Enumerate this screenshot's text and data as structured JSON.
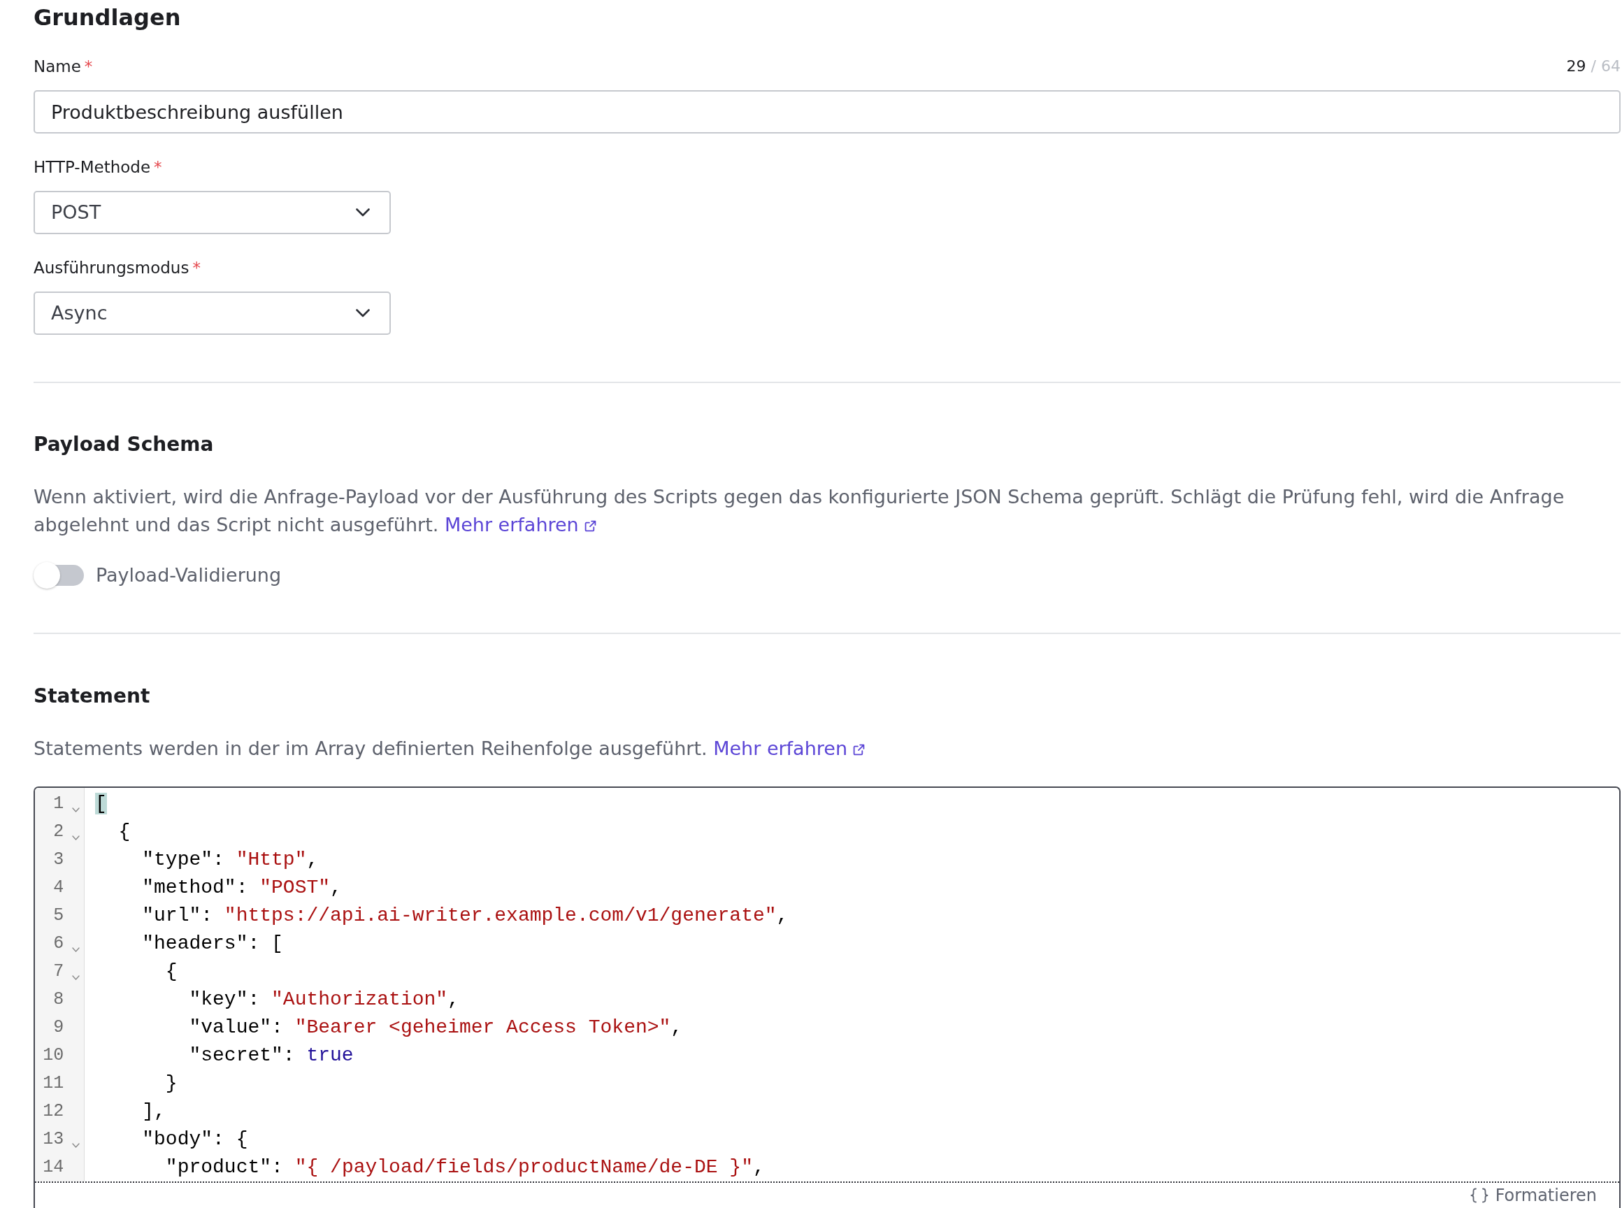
{
  "basics_section": {
    "title": "Grundlagen",
    "fields": [
      {
        "kind": "text",
        "label": "Name",
        "required_mark": "*",
        "value": "Produktbeschreibung ausfüllen",
        "counter": {
          "current": "29",
          "limit": "/ 64"
        }
      },
      {
        "kind": "select",
        "label": "HTTP-Methode",
        "required_mark": "*",
        "value": "POST"
      },
      {
        "kind": "select",
        "label": "Ausführungsmodus",
        "required_mark": "*",
        "value": "Async"
      }
    ]
  },
  "payload_schema_section": {
    "title": "Payload Schema",
    "description": "Wenn aktiviert, wird die Anfrage-Payload vor der Ausführung des Scripts gegen das konfigurierte JSON Schema geprüft. Schlägt die Prüfung fehl, wird die Anfrage abgelehnt und das Script nicht ausgeführt.",
    "link": "Mehr erfahren",
    "toggle": {
      "label": "Payload-Validierung",
      "on": false
    }
  },
  "statement_section": {
    "title": "Statement",
    "description": "Statements werden in der im Array definierten Reihenfolge ausgeführt.",
    "link": "Mehr erfahren",
    "editor": {
      "lines": [
        {
          "number": "1",
          "foldable": true,
          "tokens": [
            {
              "kind": "punct",
              "text": "[",
              "matched": true
            }
          ]
        },
        {
          "number": "2",
          "foldable": true,
          "tokens": [
            {
              "kind": "punct",
              "text": "  {",
              "matched": false
            }
          ]
        },
        {
          "number": "3",
          "foldable": false,
          "tokens": [
            {
              "kind": "key",
              "text": "    \"type\"",
              "matched": false
            },
            {
              "kind": "punct",
              "text": ": ",
              "matched": false
            },
            {
              "kind": "string",
              "text": "\"Http\"",
              "matched": false
            },
            {
              "kind": "punct",
              "text": ",",
              "matched": false
            }
          ]
        },
        {
          "number": "4",
          "foldable": false,
          "tokens": [
            {
              "kind": "key",
              "text": "    \"method\"",
              "matched": false
            },
            {
              "kind": "punct",
              "text": ": ",
              "matched": false
            },
            {
              "kind": "string",
              "text": "\"POST\"",
              "matched": false
            },
            {
              "kind": "punct",
              "text": ",",
              "matched": false
            }
          ]
        },
        {
          "number": "5",
          "foldable": false,
          "tokens": [
            {
              "kind": "key",
              "text": "    \"url\"",
              "matched": false
            },
            {
              "kind": "punct",
              "text": ": ",
              "matched": false
            },
            {
              "kind": "string",
              "text": "\"https://api.ai-writer.example.com/v1/generate\"",
              "matched": false
            },
            {
              "kind": "punct",
              "text": ",",
              "matched": false
            }
          ]
        },
        {
          "number": "6",
          "foldable": true,
          "tokens": [
            {
              "kind": "key",
              "text": "    \"headers\"",
              "matched": false
            },
            {
              "kind": "punct",
              "text": ": [",
              "matched": false
            }
          ]
        },
        {
          "number": "7",
          "foldable": true,
          "tokens": [
            {
              "kind": "punct",
              "text": "      {",
              "matched": false
            }
          ]
        },
        {
          "number": "8",
          "foldable": false,
          "tokens": [
            {
              "kind": "key",
              "text": "        \"key\"",
              "matched": false
            },
            {
              "kind": "punct",
              "text": ": ",
              "matched": false
            },
            {
              "kind": "string",
              "text": "\"Authorization\"",
              "matched": false
            },
            {
              "kind": "punct",
              "text": ",",
              "matched": false
            }
          ]
        },
        {
          "number": "9",
          "foldable": false,
          "tokens": [
            {
              "kind": "key",
              "text": "        \"value\"",
              "matched": false
            },
            {
              "kind": "punct",
              "text": ": ",
              "matched": false
            },
            {
              "kind": "string",
              "text": "\"Bearer <geheimer Access Token>\"",
              "matched": false
            },
            {
              "kind": "punct",
              "text": ",",
              "matched": false
            }
          ]
        },
        {
          "number": "10",
          "foldable": false,
          "tokens": [
            {
              "kind": "key",
              "text": "        \"secret\"",
              "matched": false
            },
            {
              "kind": "punct",
              "text": ": ",
              "matched": false
            },
            {
              "kind": "literal",
              "text": "true",
              "matched": false
            }
          ]
        },
        {
          "number": "11",
          "foldable": false,
          "tokens": [
            {
              "kind": "punct",
              "text": "      }",
              "matched": false
            }
          ]
        },
        {
          "number": "12",
          "foldable": false,
          "tokens": [
            {
              "kind": "punct",
              "text": "    ],",
              "matched": false
            }
          ]
        },
        {
          "number": "13",
          "foldable": true,
          "tokens": [
            {
              "kind": "key",
              "text": "    \"body\"",
              "matched": false
            },
            {
              "kind": "punct",
              "text": ": {",
              "matched": false
            }
          ]
        },
        {
          "number": "14",
          "foldable": false,
          "tokens": [
            {
              "kind": "key",
              "text": "      \"product\"",
              "matched": false
            },
            {
              "kind": "punct",
              "text": ": ",
              "matched": false
            },
            {
              "kind": "string",
              "text": "\"{ /payload/fields/productName/de-DE }\"",
              "matched": false
            },
            {
              "kind": "punct",
              "text": ",",
              "matched": false
            }
          ]
        }
      ],
      "format_button": "Formatieren"
    }
  }
}
